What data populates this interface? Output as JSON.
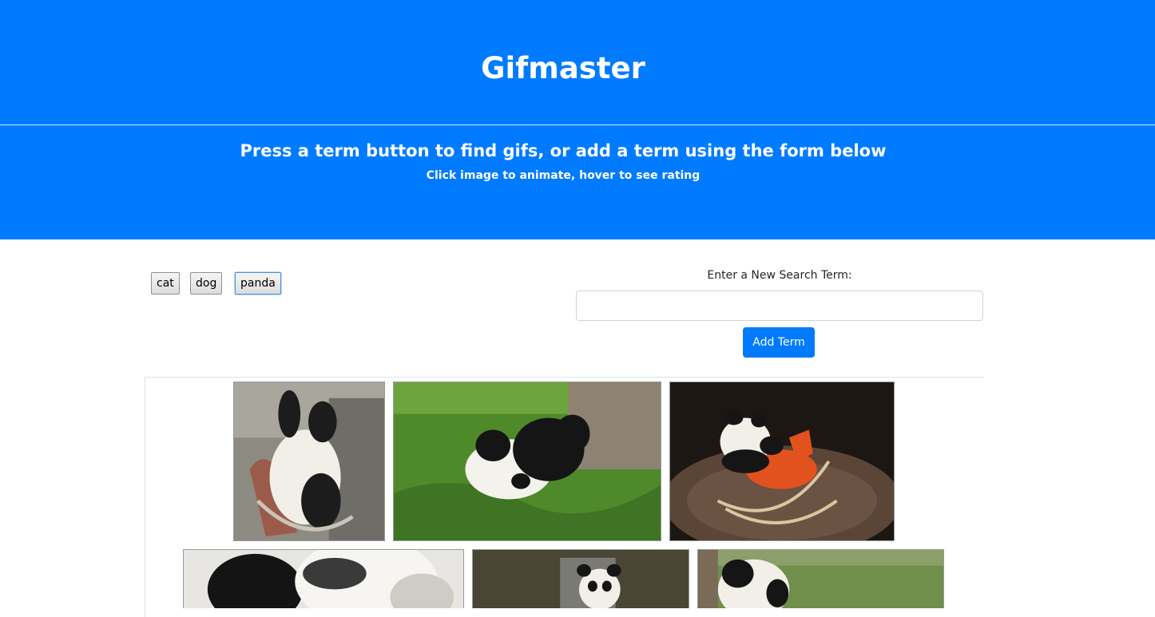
{
  "header": {
    "title": "Gifmaster",
    "lead": "Press a term button to find gifs, or add a term using the form below",
    "subtext": "Click image to animate, hover to see rating"
  },
  "terms": [
    "cat",
    "dog",
    "panda"
  ],
  "active_term": "panda",
  "form": {
    "label": "Enter a New Search Term:",
    "input_value": "",
    "button_label": "Add Term"
  },
  "colors": {
    "brand": "#007bff",
    "white": "#ffffff"
  },
  "gifs": [
    {
      "icon": "panda-rocking-chair-image"
    },
    {
      "icon": "panda-rolling-grass-image"
    },
    {
      "icon": "panda-rocking-horse-image"
    },
    {
      "icon": "panda-closeup-image"
    },
    {
      "icon": "panda-office-image"
    },
    {
      "icon": "panda-grass-image"
    }
  ]
}
